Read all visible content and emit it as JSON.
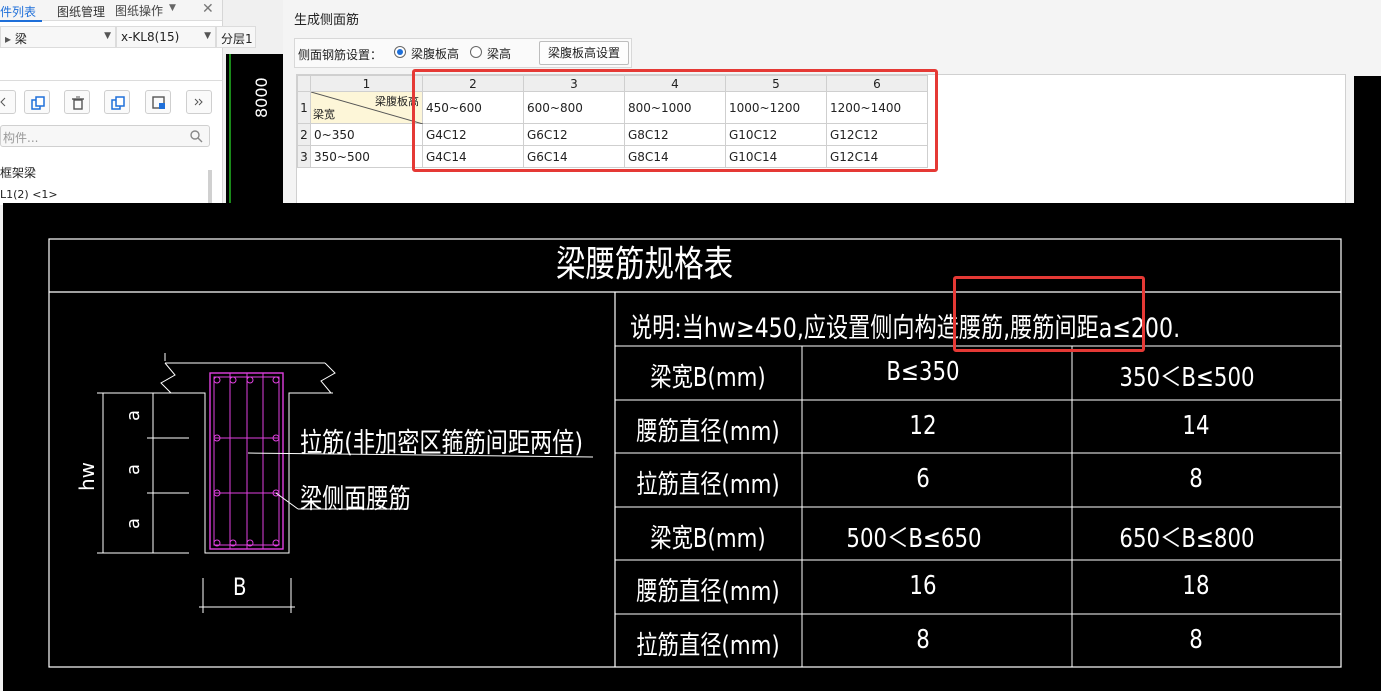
{
  "left_panel": {
    "menu_label": "图纸操作",
    "type_dropdown": "梁",
    "component_dropdown": "x-KL8(15)",
    "layer_dropdown": "分层1",
    "tabs": [
      "件列表",
      "图纸管理"
    ],
    "search_placeholder": "构件...",
    "tree_items": [
      "框架梁",
      "L1(2) <1>"
    ],
    "icons": [
      "chevron-left-icon",
      "copy-icon",
      "delete-icon",
      "duplicate-icon",
      "save-layer-icon",
      "more-icon"
    ]
  },
  "viewport": {
    "dimension_text": "8000",
    "line_color": "#1a8a1a"
  },
  "dialog": {
    "title": "生成侧面筋",
    "option_label": "侧面钢筋设置：",
    "radio_web_label": "梁腹板高",
    "radio_height_label": "梁高",
    "selected_option": "梁腹板高",
    "settings_button": "梁腹板高设置",
    "grid": {
      "col_headers": [
        "1",
        "2",
        "3",
        "4",
        "5",
        "6"
      ],
      "row_headers": [
        "1",
        "2",
        "3"
      ],
      "corner_top": "梁腹板高",
      "corner_bottom": "梁宽",
      "rows": [
        [
          "450~600",
          "600~800",
          "800~1000",
          "1000~1200",
          "1200~1400"
        ],
        [
          "0~350",
          "G4C12",
          "G6C12",
          "G8C12",
          "G10C12",
          "G12C12"
        ],
        [
          "350~500",
          "G4C14",
          "G6C14",
          "G8C14",
          "G10C14",
          "G12C14"
        ]
      ]
    }
  },
  "cad": {
    "title": "梁腰筋规格表",
    "note": "说明:当hw≥450,应设置侧向构造腰筋,腰筋间距a≤200.",
    "label_tie": "拉筋(非加密区箍筋间距两倍)",
    "label_side": "梁侧面腰筋",
    "label_hw": "hw",
    "label_b": "B",
    "label_a": "a",
    "table": [
      [
        "梁宽B(mm)",
        "B≤350",
        "350＜B≤500"
      ],
      [
        "腰筋直径(mm)",
        "12",
        "14"
      ],
      [
        "拉筋直径(mm)",
        "6",
        "8"
      ],
      [
        "梁宽B(mm)",
        "500＜B≤650",
        "650＜B≤800"
      ],
      [
        "腰筋直径(mm)",
        "16",
        "18"
      ],
      [
        "拉筋直径(mm)",
        "8",
        "8"
      ]
    ],
    "colors": {
      "beam": "#e040e0",
      "line": "#ffffff",
      "highlight": "#e53935"
    }
  }
}
